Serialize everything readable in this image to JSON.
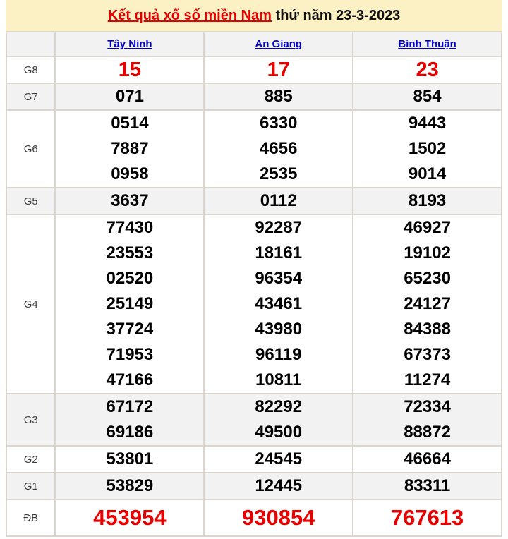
{
  "title": {
    "link": "Kết quả xổ số miền Nam",
    "suffix": "thứ năm 23-3-2023"
  },
  "colors": {
    "title_bar_bg": "#fcf1c5",
    "accent_red": "#e60000",
    "link_blue": "#0000cc",
    "row_shade": "#f2f2f2",
    "border": "#dad6ce"
  },
  "table": {
    "provinces": [
      "Tây Ninh",
      "An Giang",
      "Bình Thuận"
    ],
    "rows": [
      {
        "label": "G8",
        "style": "red-large",
        "values": [
          [
            "15"
          ],
          [
            "17"
          ],
          [
            "23"
          ]
        ]
      },
      {
        "label": "G7",
        "style": "normal",
        "values": [
          [
            "071"
          ],
          [
            "885"
          ],
          [
            "854"
          ]
        ]
      },
      {
        "label": "G6",
        "style": "normal",
        "values": [
          [
            "0514",
            "7887",
            "0958"
          ],
          [
            "6330",
            "4656",
            "2535"
          ],
          [
            "9443",
            "1502",
            "9014"
          ]
        ]
      },
      {
        "label": "G5",
        "style": "normal",
        "values": [
          [
            "3637"
          ],
          [
            "0112"
          ],
          [
            "8193"
          ]
        ]
      },
      {
        "label": "G4",
        "style": "normal",
        "values": [
          [
            "77430",
            "23553",
            "02520",
            "25149",
            "37724",
            "71953",
            "47166"
          ],
          [
            "92287",
            "18161",
            "96354",
            "43461",
            "43980",
            "96119",
            "10811"
          ],
          [
            "46927",
            "19102",
            "65230",
            "24127",
            "84388",
            "67373",
            "11274"
          ]
        ]
      },
      {
        "label": "G3",
        "style": "normal",
        "values": [
          [
            "67172",
            "69186"
          ],
          [
            "82292",
            "49500"
          ],
          [
            "72334",
            "88872"
          ]
        ]
      },
      {
        "label": "G2",
        "style": "normal",
        "values": [
          [
            "53801"
          ],
          [
            "24545"
          ],
          [
            "46664"
          ]
        ]
      },
      {
        "label": "G1",
        "style": "normal",
        "values": [
          [
            "53829"
          ],
          [
            "12445"
          ],
          [
            "83311"
          ]
        ]
      },
      {
        "label": "ĐB",
        "style": "red-xlarge",
        "values": [
          [
            "453954"
          ],
          [
            "930854"
          ],
          [
            "767613"
          ]
        ]
      }
    ]
  }
}
